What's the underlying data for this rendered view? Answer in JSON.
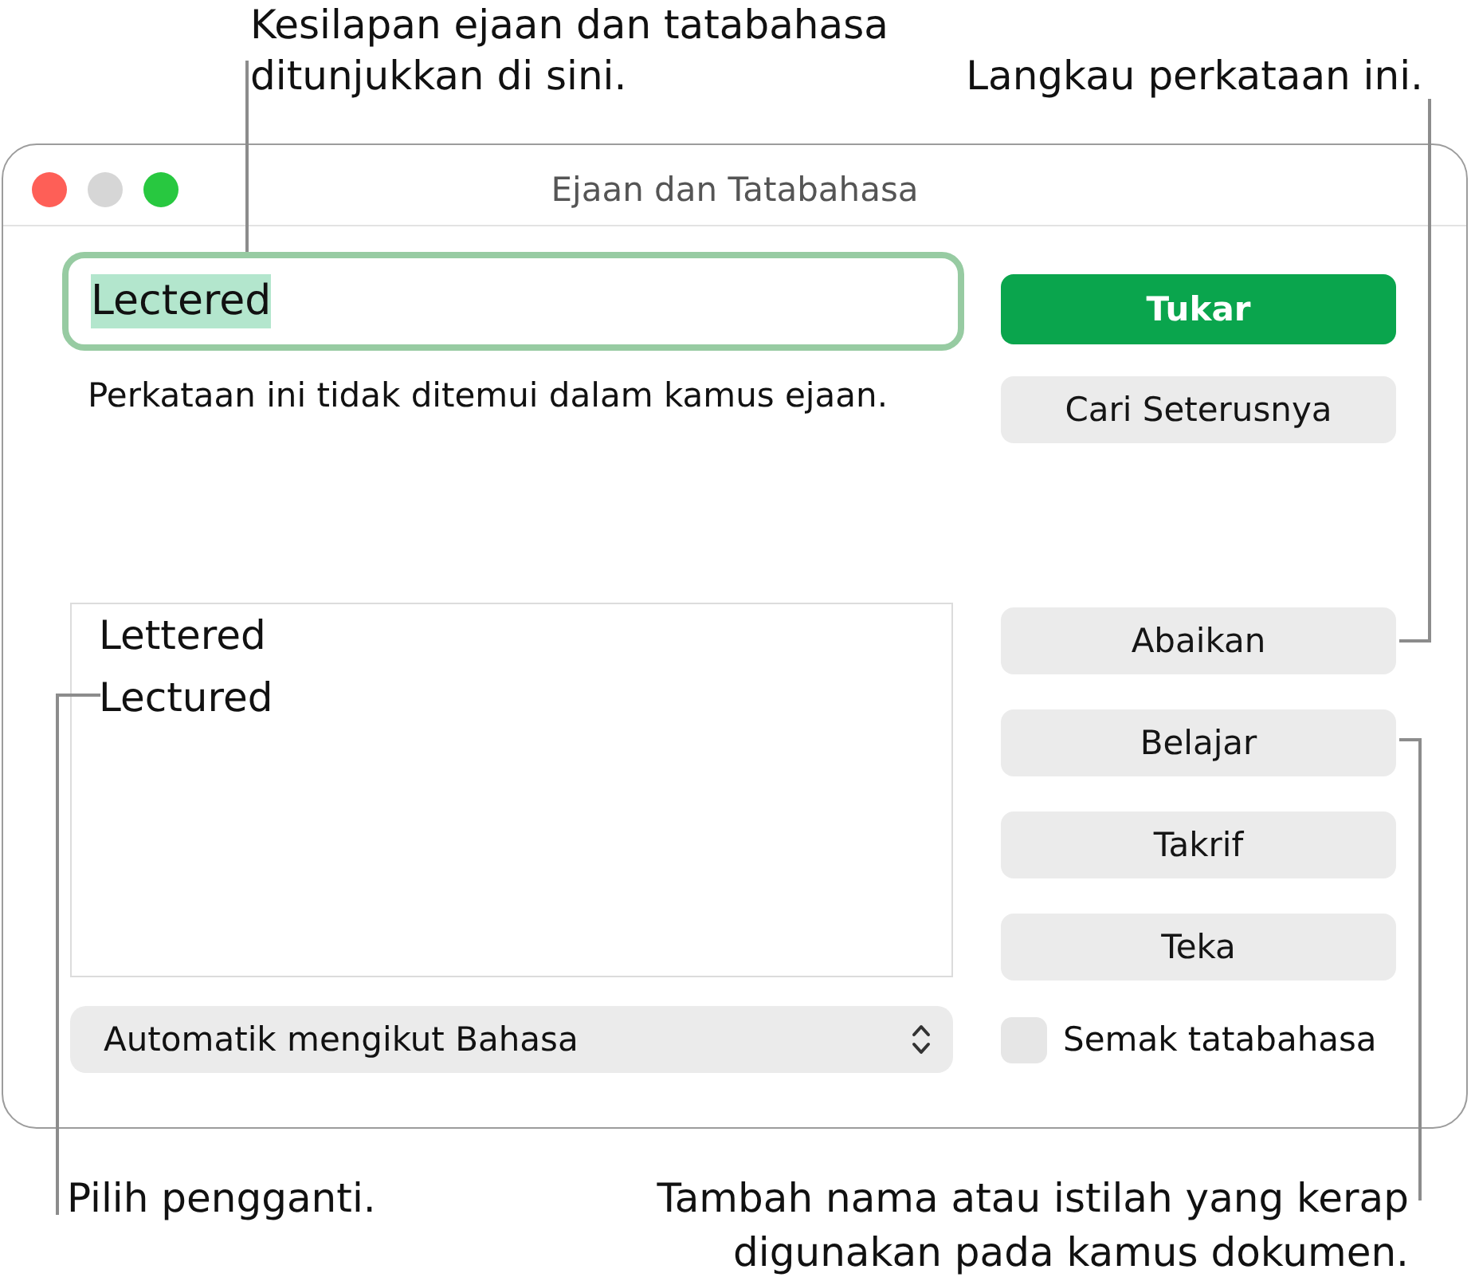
{
  "top_callouts": [
    {
      "text": "Kesilapan ejaan dan tatabahasa ditunjukkan di sini."
    },
    {
      "text": "Langkau perkataan ini."
    }
  ],
  "window": {
    "title": "Ejaan dan Tatabahasa",
    "controls": [
      {
        "kind": "close",
        "enabled": true
      },
      {
        "kind": "minimize",
        "enabled": false
      },
      {
        "kind": "zoom",
        "enabled": true
      }
    ]
  },
  "word_field": {
    "value": "Lectered",
    "focused": true,
    "text_selected": true
  },
  "message": "Perkataan ini tidak ditemui dalam kamus ejaan.",
  "primary_buttons": [
    {
      "label": "Tukar",
      "default": true
    },
    {
      "label": "Cari Seterusnya",
      "default": false
    }
  ],
  "suggestions": [
    {
      "label": "Lettered",
      "selected": false
    },
    {
      "label": "Lectured",
      "selected": false
    }
  ],
  "word_buttons": [
    {
      "label": "Abaikan",
      "default": false
    },
    {
      "label": "Belajar",
      "default": false
    },
    {
      "label": "Takrif",
      "default": false
    },
    {
      "label": "Teka",
      "default": false
    }
  ],
  "language_menu": {
    "value": "Automatik mengikut Bahasa"
  },
  "grammar_check": {
    "label": "Semak tatabahasa",
    "checked": false
  },
  "bottom_callouts": [
    {
      "text": "Pilih pengganti."
    },
    {
      "text": "Tambah nama atau istilah yang kerap digunakan pada kamus dokumen."
    }
  ]
}
